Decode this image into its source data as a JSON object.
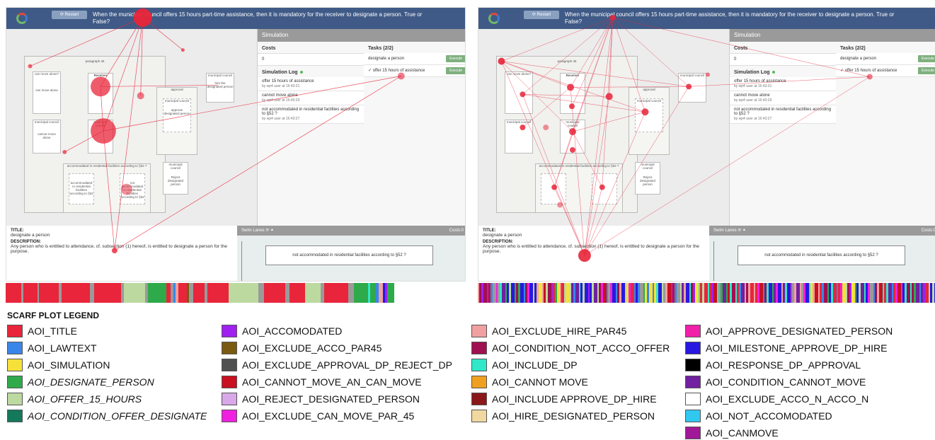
{
  "app": {
    "restart_label": "⟳ Restart",
    "question": "When the municipal council offers 15 hours part-time assistance, then it is mandatory for the receiver to designate a person. True or False?"
  },
  "simulation": {
    "header": "Simulation",
    "costs_label": "Costs",
    "costs_value": "0",
    "tasks_label": "Tasks (2/2)",
    "log_label": "Simulation Log",
    "tasks": [
      {
        "label": "designate a person",
        "action": "Execute"
      },
      {
        "label": "✓ offer 15 hours of assistance",
        "action": "Execute"
      }
    ],
    "log": [
      {
        "title": "offer 15 hours of assistance",
        "meta": "by wp4 user at 16:43:31"
      },
      {
        "title": "cannot move alone",
        "meta": "by wp4 user at 16:43:29"
      },
      {
        "title": "not accommodated in residential facilities according to §52 ?",
        "meta": "by wp4 user at 16:43:27"
      }
    ]
  },
  "info": {
    "title_label": "TITLE:",
    "title_value": "designate a person",
    "desc_label": "DESCRIPTION:",
    "desc_value": "Any person who is entitled to attendance, cf. subsection (1) hereof, is entitled to designate a person for the purpose."
  },
  "swim": {
    "label": "Swim Lanes ⟳ ⯅",
    "costs": "Costs:0",
    "box": "not accommodated in residential facilities according to §52 ?"
  },
  "diagram": {
    "paragraph": "paragraph 45",
    "can_move_alone": "can move alone?",
    "can_move_alone_inner": "can move alone",
    "receiver": "Receiver",
    "municipal_council": "municipal council",
    "cannot_move_alone": "cannot move alone",
    "offer": "offer 15 hours of assistance",
    "approval": "approval",
    "approve": "approve designated person",
    "hire": "hire the designated person",
    "accommodated": "accommodated in residential facilities according to §52 ?",
    "acc_inner": "accommodated in residential facilities according to §52",
    "not_acc": "not accommodated in residential facilities according to §52",
    "reject": "Reject designated person"
  },
  "legend": {
    "title": "SCARF PLOT LEGEND",
    "items": [
      {
        "label": "AOI_TITLE",
        "color": "#e8253a"
      },
      {
        "label": "AOI_LAWTEXT",
        "color": "#3a86e8"
      },
      {
        "label": "AOI_SIMULATION",
        "color": "#f5e13a"
      },
      {
        "label": "AOI_DESIGNATE_PERSON",
        "color": "#2eaa4a"
      },
      {
        "label": "AOI_OFFER_15_HOURS",
        "color": "#bcd9a0"
      },
      {
        "label": "AOI_CONDITION_OFFER_DESIGNATE",
        "color": "#14785a"
      },
      {
        "label": "AOI_ACCOMODATED",
        "color": "#a020f0"
      },
      {
        "label": "AOI_EXCLUDE_ACCO_PAR45",
        "color": "#7a5a10"
      },
      {
        "label": "AOI_EXCLUDE_APPROVAL_DP_REJECT_DP",
        "color": "#505050"
      },
      {
        "label": "AOI_CANNOT_MOVE_AN_CAN_MOVE",
        "color": "#c81020"
      },
      {
        "label": "AOI_REJECT_DESIGNATED_PERSON",
        "color": "#d8a8e8"
      },
      {
        "label": "AOI_EXCLUDE_CAN_MOVE_PAR_45",
        "color": "#f020e0"
      },
      {
        "label": "AOI_EXCLUDE_HIRE_PAR45",
        "color": "#f0a0a0"
      },
      {
        "label": "AOI_CONDITION_NOT_ACCO_OFFER",
        "color": "#a01050"
      },
      {
        "label": "AOI_INCLUDE_DP",
        "color": "#30e8c8"
      },
      {
        "label": "AOI_CANNOT MOVE",
        "color": "#f0a020"
      },
      {
        "label": "AOI_INCLUDE APPROVE_DP_HIRE",
        "color": "#8a1818"
      },
      {
        "label": "AOI_HIRE_DESIGNATED_PERSON",
        "color": "#f0d8a0"
      },
      {
        "label": "AOI_APPROVE_DESIGNATED_PERSON",
        "color": "#f020a8"
      },
      {
        "label": "AOI_MILESTONE_APPROVE_DP_HIRE",
        "color": "#2818e0"
      },
      {
        "label": "AOI_RESPONSE_DP_APPROVAL",
        "color": "#000000"
      },
      {
        "label": "AOI_CONDITION_CANNOT_MOVE",
        "color": "#7020a0"
      },
      {
        "label": "AOI_EXCLUDE_ACCO_N_ACCO_N",
        "color": "#ffffff"
      },
      {
        "label": "AOI_NOT_ACCOMODATED",
        "color": "#30c8f0"
      },
      {
        "label": "AOI_CANMOVE",
        "color": "#a01898"
      }
    ]
  }
}
